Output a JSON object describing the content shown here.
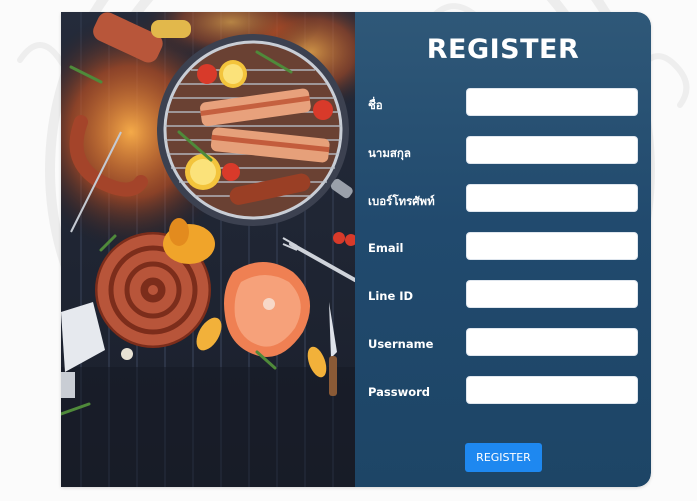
{
  "form": {
    "title": "REGISTER",
    "fields": [
      {
        "label": "ชื่อ",
        "value": ""
      },
      {
        "label": "นามสกุล",
        "value": ""
      },
      {
        "label": "เบอร์โทรศัพท์",
        "value": ""
      },
      {
        "label": "Email",
        "value": ""
      },
      {
        "label": "Line ID",
        "value": ""
      },
      {
        "label": "Username",
        "value": ""
      },
      {
        "label": "Password",
        "value": ""
      }
    ],
    "submit_label": "REGISTER"
  },
  "colors": {
    "panel": "#214a6e",
    "button": "#1e88f0",
    "page_background": "#fbfbfb"
  },
  "illustration": {
    "subject": "bbq-grill-food-illustration"
  }
}
